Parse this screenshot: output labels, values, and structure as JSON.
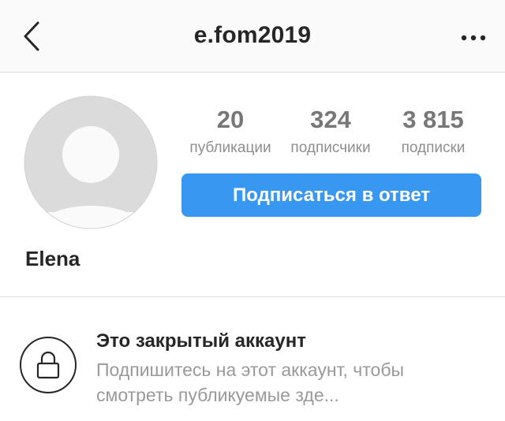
{
  "header": {
    "back_icon": "chevron-left-icon",
    "username": "e.fom2019",
    "more_icon": "more-horizontal-icon"
  },
  "profile": {
    "avatar_icon": "default-avatar-icon",
    "stats": [
      {
        "value": "20",
        "label": "публикации"
      },
      {
        "value": "324",
        "label": "подписчики"
      },
      {
        "value": "3 815",
        "label": "подписки"
      }
    ],
    "follow_button_label": "Подписаться в ответ",
    "display_name": "Elena"
  },
  "private_account": {
    "icon": "lock-icon",
    "title": "Это закрытый аккаунт",
    "description": "Подпишитесь на этот аккаунт, чтобы смотреть публикуемые зде..."
  },
  "colors": {
    "accent": "#3897f0",
    "text_primary": "#262626",
    "text_secondary": "#999999",
    "divider": "#dbdbdb",
    "header_bg": "#fafafa"
  }
}
